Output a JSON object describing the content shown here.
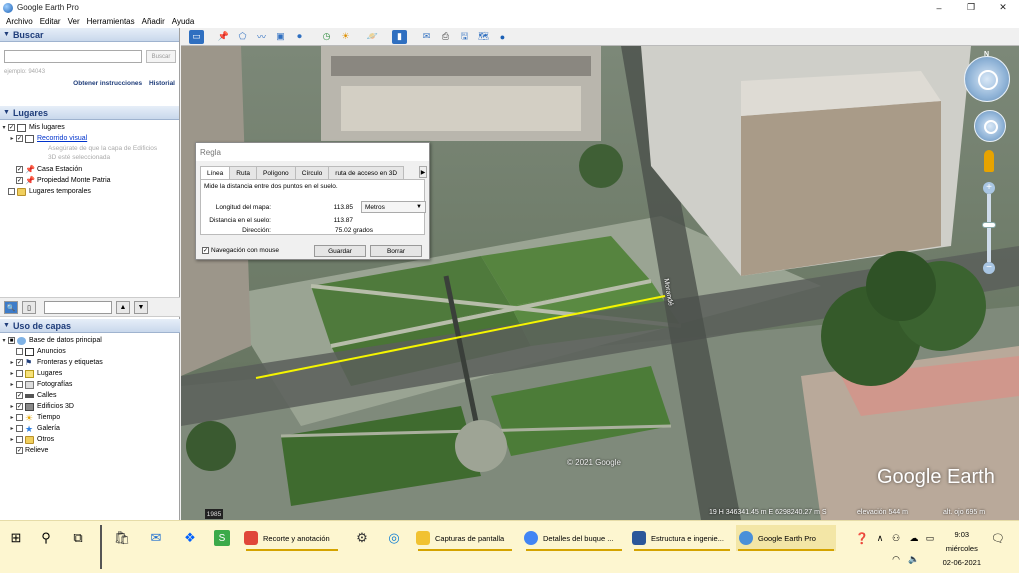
{
  "window": {
    "title": "Google Earth Pro",
    "controls": [
      "–",
      "❐",
      "✕"
    ]
  },
  "menu": [
    "Archivo",
    "Editar",
    "Ver",
    "Herramientas",
    "Añadir",
    "Ayuda"
  ],
  "search": {
    "header": "Buscar",
    "placeholder": "",
    "button": "Buscar",
    "hint": "ejemplo: 94043",
    "link_instructions": "Obtener instrucciones",
    "link_history": "Historial"
  },
  "places": {
    "header": "Lugares",
    "items": [
      {
        "label": "Mis lugares",
        "checked": true
      },
      {
        "label": "Recorrido visual",
        "checked": true
      },
      {
        "label": "Asegúrate de que la capa de Edificios",
        "note": true
      },
      {
        "label": "3D esté seleccionada",
        "note": true
      },
      {
        "label": "Casa Estación",
        "checked": true
      },
      {
        "label": "Propiedad Monte Patria",
        "checked": true
      },
      {
        "label": "Lugares temporales",
        "checked": false
      }
    ]
  },
  "layers": {
    "header": "Uso de capas",
    "items": [
      {
        "label": "Base de datos principal",
        "checked": true
      },
      {
        "label": "Anuncios",
        "checked": false
      },
      {
        "label": "Fronteras y etiquetas",
        "checked": true
      },
      {
        "label": "Lugares",
        "checked": false
      },
      {
        "label": "Fotografías",
        "checked": false
      },
      {
        "label": "Calles",
        "checked": true
      },
      {
        "label": "Edificios 3D",
        "checked": true
      },
      {
        "label": "Tiempo",
        "checked": false
      },
      {
        "label": "Galería",
        "checked": false
      },
      {
        "label": "Otros",
        "checked": false
      },
      {
        "label": "Relieve",
        "checked": true
      }
    ]
  },
  "ruler": {
    "title": "Regla",
    "tabs": [
      "Línea",
      "Ruta",
      "Polígono",
      "Círculo",
      "ruta de acceso en 3D"
    ],
    "description": "Mide la distancia entre dos puntos en el suelo.",
    "map_length_label": "Longitud del mapa:",
    "map_length_value": "113.85",
    "unit": "Metros",
    "ground_length_label": "Distancia en el suelo:",
    "ground_length_value": "113.87",
    "heading_label": "Dirección:",
    "heading_value": "75.02 grados",
    "mouse_nav_label": "Navegación con mouse",
    "mouse_nav_checked": true,
    "save_button": "Guardar",
    "clear_button": "Borrar"
  },
  "map": {
    "copyright": "© 2021 Google",
    "street_label": "Morandé",
    "status_year": "1985",
    "status_coords": "19 H 346341.45 m E 6298240.27 m S",
    "status_elevation": "elevación 544 m",
    "status_alt": "alt. ojo 695 m",
    "watermark": "Google Earth",
    "measure_line_color": "#f5f500"
  },
  "taskbar": {
    "apps": [
      {
        "label": "Recorte y anotación",
        "color": "#e0473a"
      },
      {
        "label": "Capturas de pantalla",
        "color": "#f1c232"
      },
      {
        "label": "Detalles del buque ...",
        "color": "#4285f4"
      },
      {
        "label": "Estructura e ingenie...",
        "color": "#2b579a"
      },
      {
        "label": "Google Earth Pro",
        "color": "#4a90d9"
      }
    ],
    "time": "9:03",
    "day": "miércoles",
    "date": "02-06-2021"
  }
}
